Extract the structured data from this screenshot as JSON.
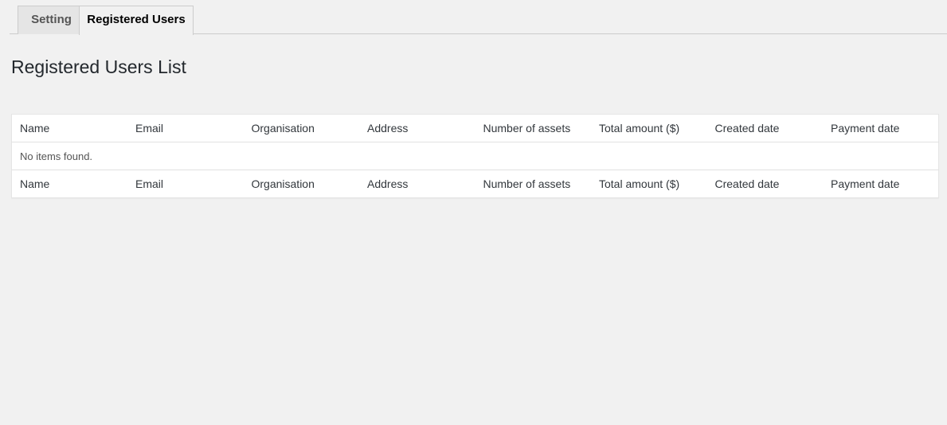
{
  "tabs": [
    {
      "label": "Setting",
      "active": false
    },
    {
      "label": "Registered Users",
      "active": true
    }
  ],
  "page_title": "Registered Users List",
  "table": {
    "columns": [
      "Name",
      "Email",
      "Organisation",
      "Address",
      "Number of assets",
      "Total amount ($)",
      "Created date",
      "Payment date"
    ],
    "rows": [],
    "empty_message": "No items found."
  },
  "colors": {
    "background": "#f1f1f1",
    "table_background": "#ffffff",
    "border": "#e5e5e5"
  }
}
